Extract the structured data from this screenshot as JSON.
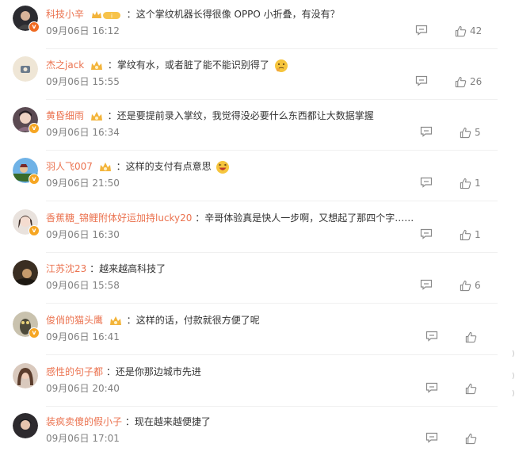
{
  "comments": [
    {
      "user": "科技小辛",
      "text": "这个掌纹机器长得很像 OPPO 小折叠，有没有？",
      "time": "09月06日 16:12",
      "likes": "42",
      "badge": "vip",
      "verified": "red",
      "avatar_color": "#2b2b30"
    },
    {
      "user": "杰之jack",
      "text": "掌纹有水，或者脏了能不能识别得了",
      "time": "09月06日 15:55",
      "likes": "26",
      "badge": "crown",
      "verified": "",
      "avatar_color": "#efe6d6",
      "emoji": "think"
    },
    {
      "user": "黄昏细雨",
      "text": "还是要提前录入掌纹，我觉得没必要什么东西都让大数据掌握",
      "time": "09月06日 16:34",
      "likes": "5",
      "badge": "crown",
      "verified": "yellow",
      "avatar_color": "#5b4a52"
    },
    {
      "user": "羽人飞007",
      "text": "这样的支付有点意思",
      "time": "09月06日 21:50",
      "likes": "1",
      "badge": "crown",
      "verified": "yellow",
      "avatar_color": "#2f6fb0",
      "emoji": "laugh"
    },
    {
      "user": "香蕉糖_锦鲤附体好运加持lucky20",
      "text": "辛哥体验真是快人一步啊，又想起了那四个字……",
      "time": "09月06日 16:30",
      "likes": "1",
      "badge": "",
      "verified": "yellow",
      "avatar_color": "#c7b7ae"
    },
    {
      "user": "江苏沈23",
      "text": "越来越高科技了",
      "time": "09月06日 15:58",
      "likes": "6",
      "badge": "",
      "verified": "",
      "avatar_color": "#3a2e22"
    },
    {
      "user": "俊俏的猫头鹰",
      "text": "这样的话，付款就很方便了呢",
      "time": "09月06日 16:41",
      "likes": "",
      "badge": "crown",
      "verified": "yellow",
      "avatar_color": "#4d4a3a"
    },
    {
      "user": "感性的句子都",
      "text": "还是你那边城市先进",
      "time": "09月06日 20:40",
      "likes": "",
      "badge": "",
      "verified": "",
      "avatar_color": "#6e5c50"
    },
    {
      "user": "装疯卖傻的假小子",
      "text": "现在越来越便捷了",
      "time": "09月06日 17:01",
      "likes": "",
      "badge": "",
      "verified": "",
      "avatar_color": "#2d2a2e"
    }
  ],
  "colors": {
    "username": "#eb7350",
    "meta": "#808080",
    "text": "#333333"
  },
  "icons": {
    "reply": "comment-icon",
    "like": "thumb-up-icon",
    "badge_vip": "vip-crown-badge-icon",
    "badge_crown": "crown-badge-icon"
  }
}
